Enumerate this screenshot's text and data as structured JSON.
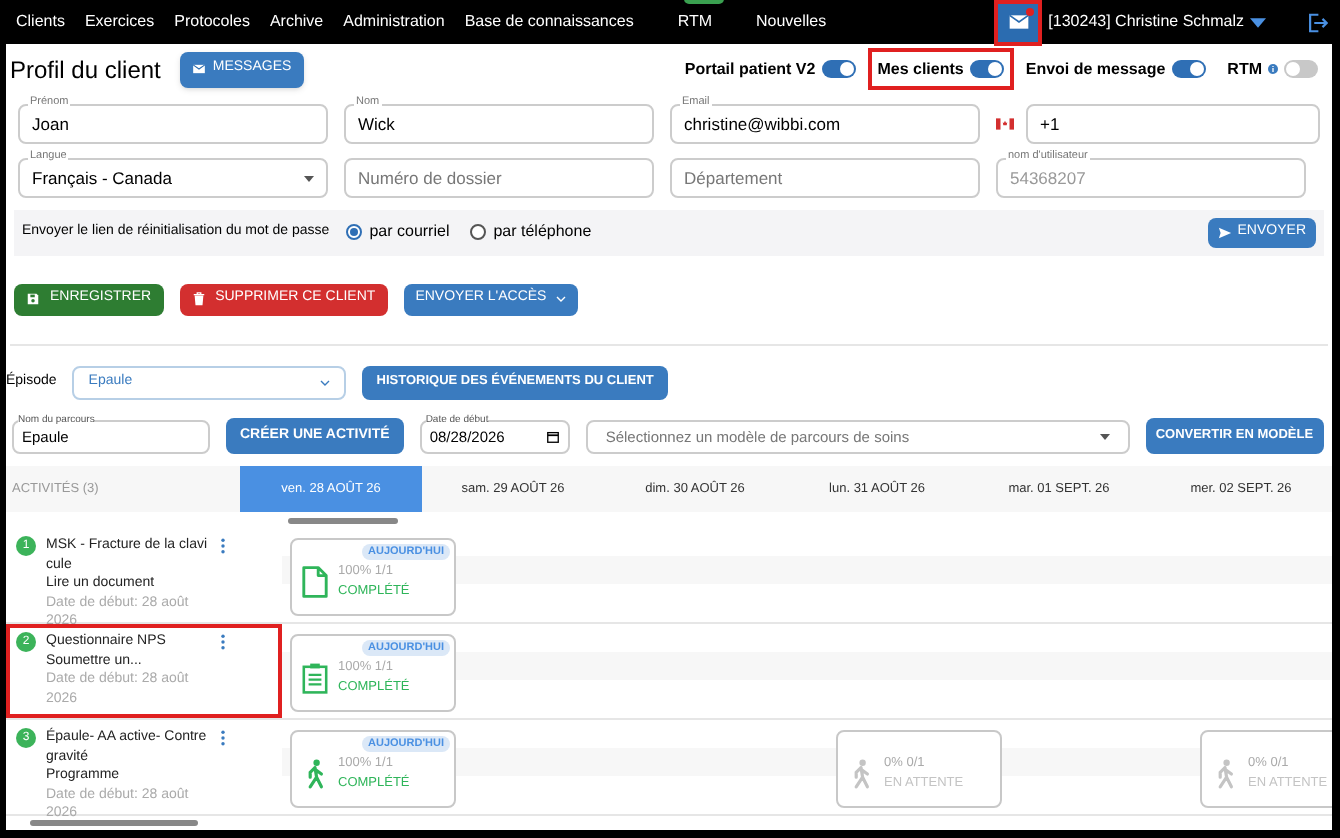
{
  "nav": {
    "items": [
      {
        "label": "Clients"
      },
      {
        "label": "Exercices"
      },
      {
        "label": "Protocoles"
      },
      {
        "label": "Archive"
      },
      {
        "label": "Administration"
      },
      {
        "label": "Base de connaissances"
      },
      {
        "label": "RTM",
        "badge": true
      },
      {
        "label": "Nouvelles"
      }
    ],
    "mail": {
      "highlighted": true,
      "unread": true
    },
    "user": "[130243] Christine Schmalz"
  },
  "profile": {
    "title": "Profil du client",
    "messages_button": "MESSAGES",
    "toggles": [
      {
        "label": "Portail patient V2",
        "on": true,
        "highlighted": false,
        "info": false
      },
      {
        "label": "Mes clients",
        "on": true,
        "highlighted": true,
        "info": false
      },
      {
        "label": "Envoi de message",
        "on": true,
        "highlighted": false,
        "info": false
      },
      {
        "label": "RTM",
        "on": false,
        "highlighted": false,
        "info": true
      }
    ]
  },
  "fields": [
    [
      {
        "kind": "text",
        "label": "Prénom",
        "value": "Joan"
      },
      {
        "kind": "text",
        "label": "Nom",
        "value": "Wick"
      },
      {
        "kind": "text",
        "label": "Email",
        "value": "christine@wibbi.com"
      },
      {
        "kind": "phone",
        "value": "+1"
      }
    ],
    [
      {
        "kind": "select",
        "label": "Langue",
        "value": "Français - Canada"
      },
      {
        "kind": "text",
        "placeholder": "Numéro de dossier"
      },
      {
        "kind": "text",
        "placeholder": "Département"
      },
      {
        "kind": "readonly",
        "label": "nom d'utilisateur",
        "value": "54368207"
      }
    ]
  ],
  "reset": {
    "label": "Envoyer le lien de réinitialisation du mot de passe",
    "options": [
      {
        "label": "par courriel",
        "selected": true
      },
      {
        "label": "par téléphone",
        "selected": false
      }
    ],
    "button": "ENVOYER"
  },
  "actions": [
    {
      "kind": "save",
      "label": "ENREGISTRER"
    },
    {
      "kind": "delete",
      "label": "SUPPRIMER CE CLIENT"
    },
    {
      "kind": "dropdown",
      "label": "ENVOYER L'ACCÈS"
    }
  ],
  "episode": {
    "label": "Épisode",
    "value": "Epaule",
    "history_button": "HISTORIQUE DES ÉVÉNEMENTS DU CLIENT"
  },
  "parcours": {
    "name_label": "Nom du parcours",
    "name": "Epaule",
    "create_button": "CRÉER UNE ACTIVITÉ",
    "date_label": "Date de début",
    "date": "08/28/2026",
    "template_placeholder": "Sélectionnez un modèle de parcours de soins",
    "convert_button": "CONVERTIR EN MODÈLE"
  },
  "timeline": {
    "heading": "ACTIVITÉS (3)",
    "days": [
      {
        "label": "ven. 28 AOÛT 26",
        "selected": true
      },
      {
        "label": "sam. 29 AOÛT 26",
        "selected": false
      },
      {
        "label": "dim. 30 AOÛT 26",
        "selected": false
      },
      {
        "label": "lun. 31 AOÛT 26",
        "selected": false
      },
      {
        "label": "mar. 01 SEPT. 26",
        "selected": false
      },
      {
        "label": "mer. 02 SEPT. 26",
        "selected": false
      }
    ],
    "activities": [
      {
        "number": "1",
        "kind": "document",
        "title": "MSK - Fracture de la clavicule",
        "type": "Lire un document",
        "date": "Date de début: 28 août 2026",
        "highlighted": false,
        "schedule": [
          {
            "kind": "card",
            "today": "AUJOURD'HUI",
            "progress": "100% 1/1",
            "status": "COMPLÉTÉ",
            "complete": true
          },
          {
            "kind": "empty"
          },
          {
            "kind": "empty"
          },
          {
            "kind": "empty"
          },
          {
            "kind": "empty"
          },
          {
            "kind": "empty"
          }
        ]
      },
      {
        "number": "2",
        "kind": "questionnaire",
        "title": "Questionnaire NPS",
        "type": "Soumettre un...",
        "date": "Date de début: 28 août 2026",
        "highlighted": true,
        "schedule": [
          {
            "kind": "card",
            "today": "AUJOURD'HUI",
            "progress": "100% 1/1",
            "status": "COMPLÉTÉ",
            "complete": true
          },
          {
            "kind": "empty"
          },
          {
            "kind": "empty"
          },
          {
            "kind": "empty"
          },
          {
            "kind": "empty"
          },
          {
            "kind": "empty"
          }
        ]
      },
      {
        "number": "3",
        "kind": "exercise",
        "title": "Épaule- AA active- Contre gravité",
        "type": "Programme",
        "date": "Date de début: 28 août 2026",
        "highlighted": false,
        "schedule": [
          {
            "kind": "card",
            "today": "AUJOURD'HUI",
            "progress": "100% 1/1",
            "status": "COMPLÉTÉ",
            "complete": true
          },
          {
            "kind": "empty"
          },
          {
            "kind": "empty"
          },
          {
            "kind": "card",
            "progress": "0% 0/1",
            "status": "EN ATTENTE",
            "complete": false
          },
          {
            "kind": "empty"
          },
          {
            "kind": "card",
            "progress": "0% 0/1",
            "status": "EN ATTENTE",
            "complete": false
          }
        ]
      }
    ]
  }
}
